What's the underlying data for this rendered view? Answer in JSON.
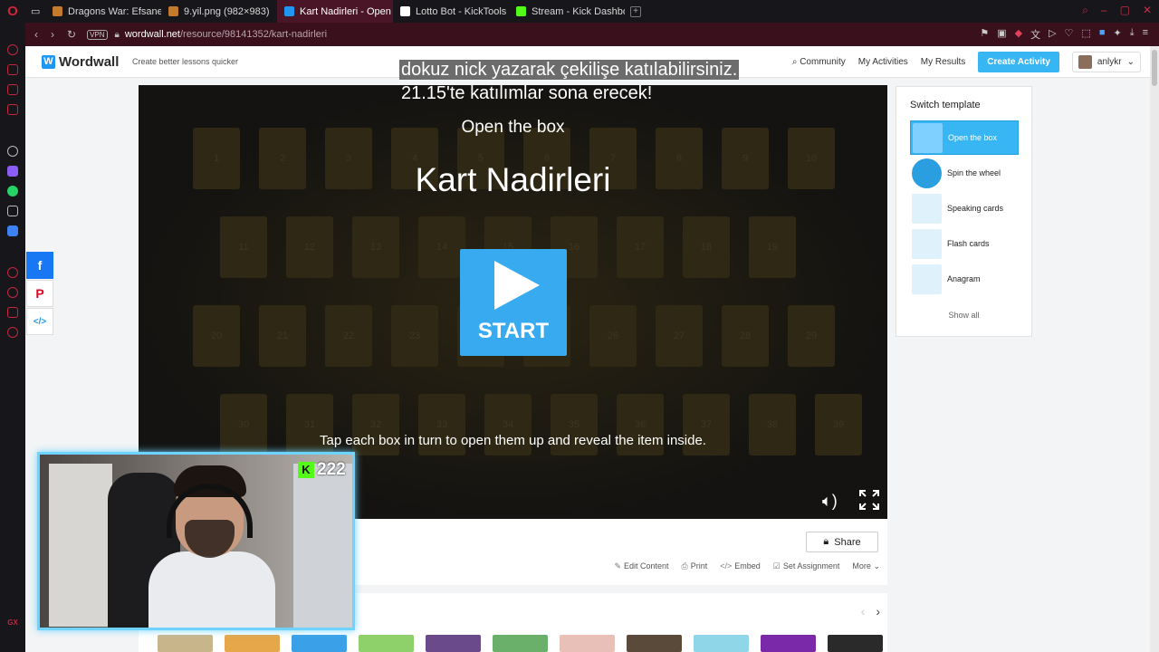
{
  "browser": {
    "tabs": [
      {
        "label": "Dragons War: Efsane Ejde",
        "color": "#c27a2c",
        "active": false
      },
      {
        "label": "9.yil.png (982×983)",
        "color": "#c27a2c",
        "active": false
      },
      {
        "label": "Kart Nadirleri - Open the",
        "color": "#1f96f2",
        "active": true
      },
      {
        "label": "Lotto Bot - KickTools",
        "color": "#ffffff",
        "active": false
      },
      {
        "label": "Stream - Kick Dashboard",
        "color": "#53fc18",
        "active": false
      }
    ],
    "vpn_label": "VPN",
    "url_host": "wordwall.net",
    "url_path": "/resource/98141352/kart-nadirleri"
  },
  "header": {
    "logo_text": "Wordwall",
    "tagline": "Create better lessons quicker",
    "community": "Community",
    "my_activities": "My Activities",
    "my_results": "My Results",
    "create_activity": "Create Activity",
    "username": "anlykr"
  },
  "overlay": {
    "line1": "dokuz nick yazarak çekilişe katılabilirsiniz.",
    "line2": "21.15'te katılımlar sona erecek!"
  },
  "game": {
    "template_name": "Open the box",
    "title": "Kart Nadirleri",
    "start_label": "START",
    "instructions": "Tap each box in turn to open them up and reveal the item inside.",
    "box_numbers": [
      "1",
      "2",
      "3",
      "4",
      "5",
      "6",
      "7",
      "8",
      "9",
      "10",
      "11",
      "12",
      "13",
      "14",
      "15",
      "16",
      "17",
      "18",
      "19",
      "20",
      "21",
      "22",
      "23",
      "24",
      "25",
      "26",
      "27",
      "28",
      "29",
      "30",
      "31",
      "32",
      "33",
      "34",
      "35",
      "36",
      "37",
      "38",
      "39"
    ]
  },
  "below": {
    "share": "Share",
    "edit_content": "Edit Content",
    "print": "Print",
    "embed": "Embed",
    "set_assignment": "Set Assignment",
    "more": "More"
  },
  "switch_template": {
    "heading": "Switch template",
    "items": [
      "Open the box",
      "Spin the wheel",
      "Speaking cards",
      "Flash cards",
      "Anagram"
    ],
    "show_all": "Show all"
  },
  "webcam": {
    "viewer_count": "222"
  },
  "colors": {
    "accent": "#38b6f4",
    "kick_green": "#53fc18",
    "opera_red": "#c4263f"
  }
}
